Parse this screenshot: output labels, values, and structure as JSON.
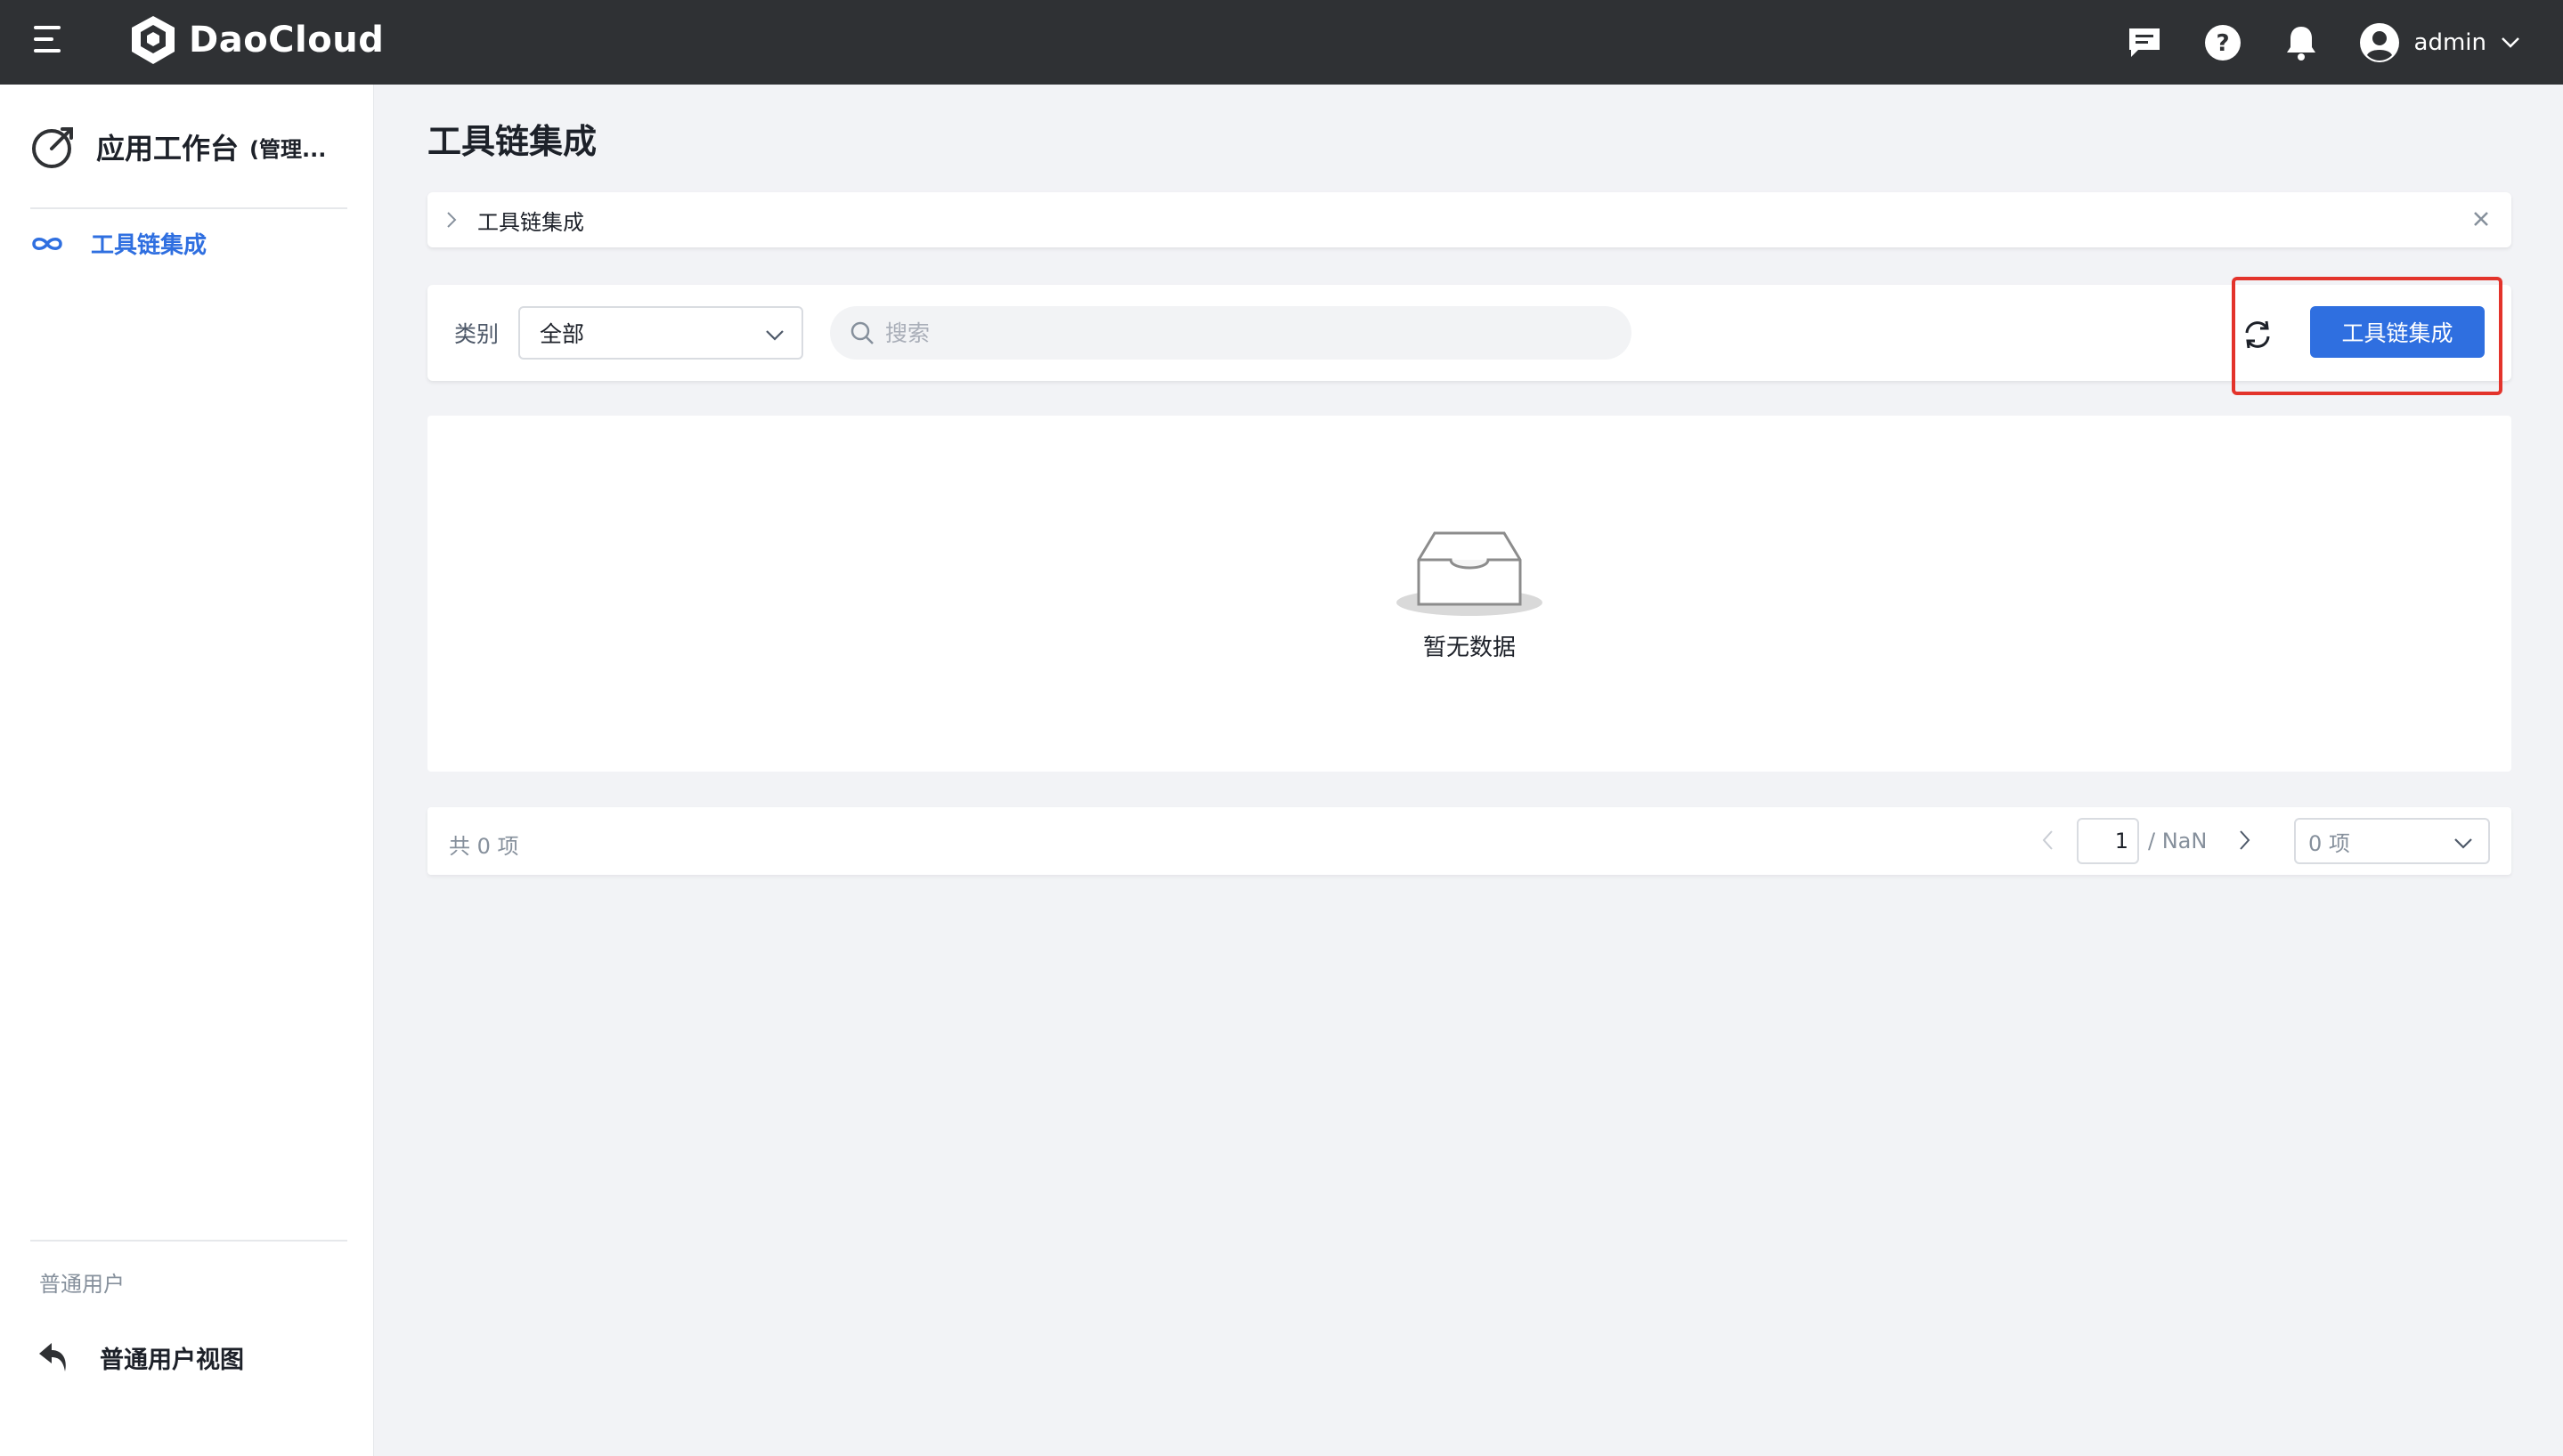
{
  "header": {
    "brand": "DaoCloud",
    "user": "admin"
  },
  "sidebar": {
    "app_title": "应用工作台",
    "app_subtitle": "(管理...",
    "items": [
      {
        "label": "工具链集成",
        "icon": "infinity-icon",
        "active": true
      }
    ],
    "section_label": "普通用户",
    "user_view_label": "普通用户视图"
  },
  "main": {
    "page_title": "工具链集成",
    "breadcrumb": {
      "label": "工具链集成"
    },
    "toolbar": {
      "filter_label": "类别",
      "filter_value": "全部",
      "search_placeholder": "搜索",
      "primary_button": "工具链集成"
    },
    "empty_text": "暂无数据",
    "pagination": {
      "total": "共 0 项",
      "current_page": "1",
      "page_total": "/ NaN",
      "page_size": "0 项"
    }
  },
  "colors": {
    "topbar": "#2f3134",
    "accent": "#2f6fe0",
    "highlight": "#e3332b",
    "background": "#f2f3f6"
  }
}
